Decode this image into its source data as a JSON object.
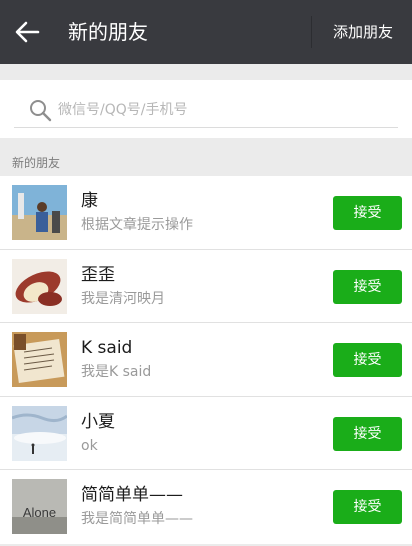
{
  "header": {
    "title": "新的朋友",
    "add_friend": "添加朋友"
  },
  "search": {
    "placeholder": "微信号/QQ号/手机号"
  },
  "section_label": "新的朋友",
  "accept_label": "接受",
  "requests": [
    {
      "name": "康",
      "message": "根据文章提示操作"
    },
    {
      "name": "歪歪",
      "message": "我是清河映月"
    },
    {
      "name": "K said",
      "message": "我是K said"
    },
    {
      "name": "小夏",
      "message": "ok"
    },
    {
      "name": "简简单单——",
      "message": "我是简简单单——",
      "avatar_text": "Alone"
    }
  ],
  "colors": {
    "header_bg": "#393a3f",
    "accept_green": "#1aad19",
    "page_bg": "#ebebeb"
  }
}
